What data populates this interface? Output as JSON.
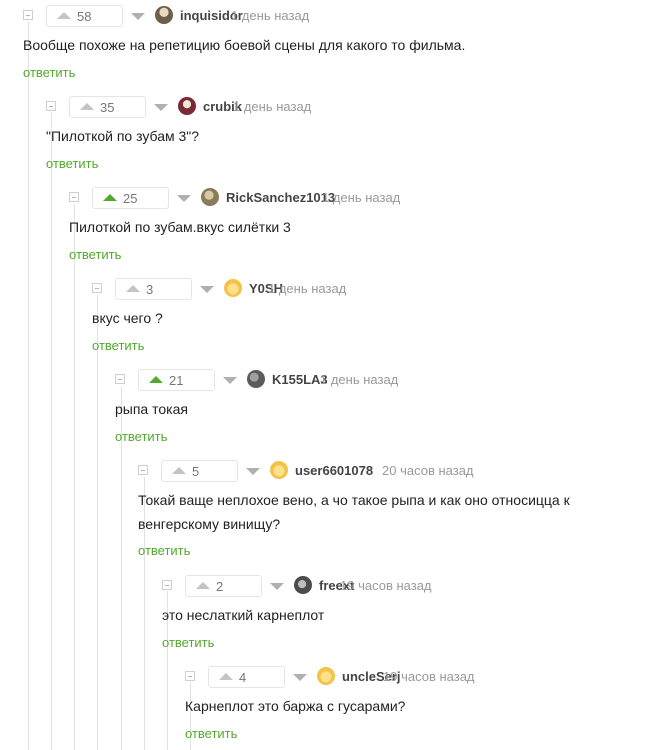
{
  "comments": [
    {
      "votes": "58",
      "up_active": false,
      "user": "inquisidor",
      "time": "1 день назад",
      "text": "Вообще похоже на репетицию боевой сцены для какого то фильма.",
      "avatar_color": "#6d5f4b",
      "reply": "ответить"
    },
    {
      "votes": "35",
      "up_active": false,
      "user": "crubik",
      "time": "1 день назад",
      "text": "\"Пилоткой по зубам 3\"?",
      "avatar_color": "#7a2a36",
      "reply": "ответить"
    },
    {
      "votes": "25",
      "up_active": true,
      "user": "RickSanchez1013",
      "time": "1 день назад",
      "text": "Пилоткой по зубам.вкус силётки 3",
      "avatar_color": "#8a7b5a",
      "reply": "ответить"
    },
    {
      "votes": "3",
      "up_active": false,
      "user": "Y0SH",
      "time": "1 день назад",
      "text": "вкус чего ?",
      "avatar_color": "#f2c24b",
      "reply": "ответить"
    },
    {
      "votes": "21",
      "up_active": true,
      "user": "K155LA3",
      "time": "1 день назад",
      "text": "рыпа токая",
      "avatar_color": "#5b5b5b",
      "reply": "ответить"
    },
    {
      "votes": "5",
      "up_active": false,
      "user": "user6601078",
      "time": "20 часов назад",
      "text_line1": "Токай ваще неплохое вено, а чо такое рыпа и как оно относицца к",
      "text_line2": "венгерскому винищу?",
      "avatar_color": "#f2c24b",
      "reply": "ответить"
    },
    {
      "votes": "2",
      "up_active": false,
      "user": "freext",
      "time": "19 часов назад",
      "text": "это неслаткий карнеплот",
      "avatar_color": "#4c4c4c",
      "reply": "ответить"
    },
    {
      "votes": "4",
      "up_active": false,
      "user": "uncleSerj",
      "time": "19 часов назад",
      "text": "Карнеплот это баржа с гусарами?",
      "avatar_color": "#f2c24b",
      "reply": "ответить"
    }
  ],
  "icons": {
    "collapse": "minus-box-icon",
    "upvote": "triangle-up-icon",
    "downvote": "triangle-down-icon",
    "avatar": "user-avatar"
  },
  "colors": {
    "accent": "#52a92d",
    "muted": "#999999",
    "line": "#e2e2e2"
  }
}
